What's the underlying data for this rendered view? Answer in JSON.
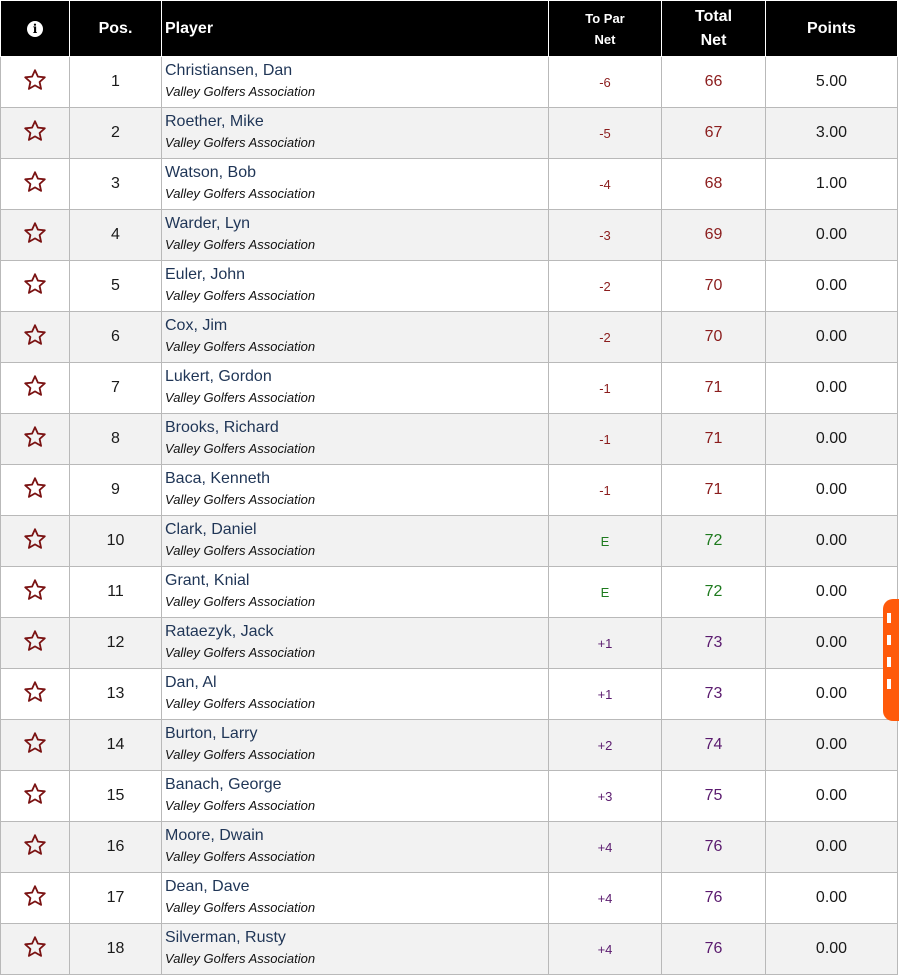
{
  "header": {
    "info_icon": "i",
    "pos": "Pos.",
    "player": "Player",
    "to_par_line1": "To Par",
    "to_par_line2": "Net",
    "total_line1": "Total",
    "total_line2": "Net",
    "points": "Points"
  },
  "colors": {
    "under_par": "#8b1d1d",
    "even_par": "#1e7a1e",
    "over_par": "#5a1a6e",
    "header_bg": "#000000",
    "accent_tab": "#ff5a0a"
  },
  "icons": {
    "row_action": "star-outline-icon",
    "header": "info-icon"
  },
  "rows": [
    {
      "pos": "1",
      "name": "Christiansen, Dan",
      "club": "Valley Golfers Association",
      "to_par": "-6",
      "total": "66",
      "points": "5.00",
      "state": "under"
    },
    {
      "pos": "2",
      "name": "Roether, Mike",
      "club": "Valley Golfers Association",
      "to_par": "-5",
      "total": "67",
      "points": "3.00",
      "state": "under"
    },
    {
      "pos": "3",
      "name": "Watson, Bob",
      "club": "Valley Golfers Association",
      "to_par": "-4",
      "total": "68",
      "points": "1.00",
      "state": "under"
    },
    {
      "pos": "4",
      "name": "Warder, Lyn",
      "club": "Valley Golfers Association",
      "to_par": "-3",
      "total": "69",
      "points": "0.00",
      "state": "under"
    },
    {
      "pos": "5",
      "name": "Euler, John",
      "club": "Valley Golfers Association",
      "to_par": "-2",
      "total": "70",
      "points": "0.00",
      "state": "under"
    },
    {
      "pos": "6",
      "name": "Cox, Jim",
      "club": "Valley Golfers Association",
      "to_par": "-2",
      "total": "70",
      "points": "0.00",
      "state": "under"
    },
    {
      "pos": "7",
      "name": "Lukert, Gordon",
      "club": "Valley Golfers Association",
      "to_par": "-1",
      "total": "71",
      "points": "0.00",
      "state": "under"
    },
    {
      "pos": "8",
      "name": "Brooks, Richard",
      "club": "Valley Golfers Association",
      "to_par": "-1",
      "total": "71",
      "points": "0.00",
      "state": "under"
    },
    {
      "pos": "9",
      "name": "Baca, Kenneth",
      "club": "Valley Golfers Association",
      "to_par": "-1",
      "total": "71",
      "points": "0.00",
      "state": "under"
    },
    {
      "pos": "10",
      "name": "Clark, Daniel",
      "club": "Valley Golfers Association",
      "to_par": "E",
      "total": "72",
      "points": "0.00",
      "state": "even"
    },
    {
      "pos": "11",
      "name": "Grant, Knial",
      "club": "Valley Golfers Association",
      "to_par": "E",
      "total": "72",
      "points": "0.00",
      "state": "even"
    },
    {
      "pos": "12",
      "name": "Rataezyk, Jack",
      "club": "Valley Golfers Association",
      "to_par": "+1",
      "total": "73",
      "points": "0.00",
      "state": "over"
    },
    {
      "pos": "13",
      "name": "Dan, Al",
      "club": "Valley Golfers Association",
      "to_par": "+1",
      "total": "73",
      "points": "0.00",
      "state": "over"
    },
    {
      "pos": "14",
      "name": "Burton, Larry",
      "club": "Valley Golfers Association",
      "to_par": "+2",
      "total": "74",
      "points": "0.00",
      "state": "over"
    },
    {
      "pos": "15",
      "name": "Banach, George",
      "club": "Valley Golfers Association",
      "to_par": "+3",
      "total": "75",
      "points": "0.00",
      "state": "over"
    },
    {
      "pos": "16",
      "name": "Moore, Dwain",
      "club": "Valley Golfers Association",
      "to_par": "+4",
      "total": "76",
      "points": "0.00",
      "state": "over"
    },
    {
      "pos": "17",
      "name": "Dean, Dave",
      "club": "Valley Golfers Association",
      "to_par": "+4",
      "total": "76",
      "points": "0.00",
      "state": "over"
    },
    {
      "pos": "18",
      "name": "Silverman, Rusty",
      "club": "Valley Golfers Association",
      "to_par": "+4",
      "total": "76",
      "points": "0.00",
      "state": "over"
    }
  ]
}
